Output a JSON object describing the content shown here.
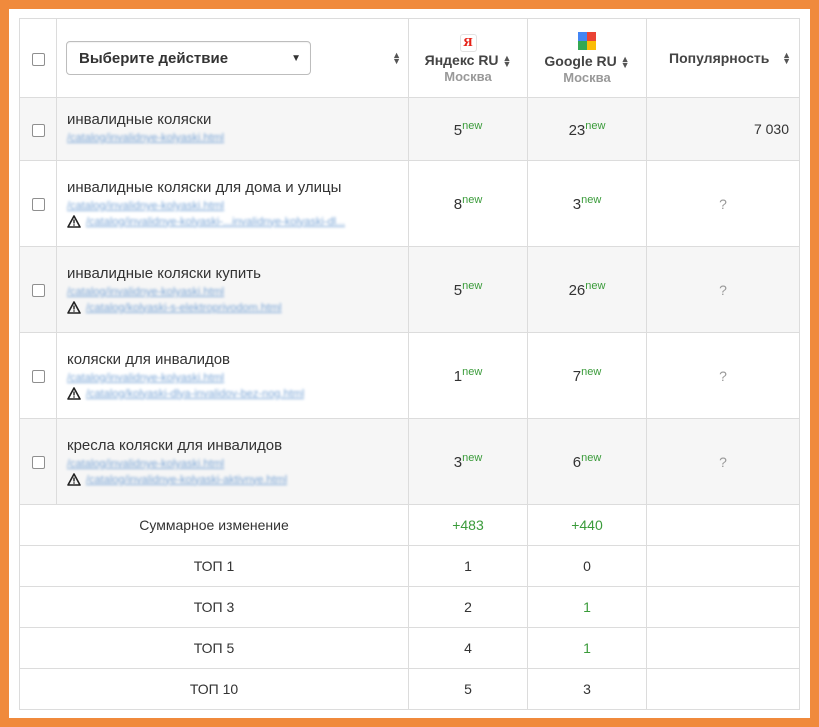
{
  "header": {
    "action_select": "Выберите действие",
    "yandex": {
      "name": "Яндекс RU",
      "city": "Москва",
      "logo": "Я"
    },
    "google": {
      "name": "Google RU",
      "city": "Москва"
    },
    "popularity": "Популярность"
  },
  "rows": [
    {
      "keyword": "инвалидные коляски",
      "url1": "/catalog/invalidnye-kolyaski.html",
      "url2": "",
      "yandex": "5",
      "google": "23",
      "badge": "new",
      "popularity": "7 030"
    },
    {
      "keyword": "инвалидные коляски для дома и улицы",
      "url1": "/catalog/invalidnye-kolyaski.html",
      "url2": "/catalog/invalidnye-kolyaski-...invalidnye-kolyaski-dl...",
      "yandex": "8",
      "google": "3",
      "badge": "new",
      "popularity": "?"
    },
    {
      "keyword": "инвалидные коляски купить",
      "url1": "/catalog/invalidnye-kolyaski.html",
      "url2": "/catalog/kolyaski-s-elektroprivodom.html",
      "yandex": "5",
      "google": "26",
      "badge": "new",
      "popularity": "?"
    },
    {
      "keyword": "коляски для инвалидов",
      "url1": "/catalog/invalidnye-kolyaski.html",
      "url2": "/catalog/kolyaski-dlya-invalidov-bez-nog.html",
      "yandex": "1",
      "google": "7",
      "badge": "new",
      "popularity": "?"
    },
    {
      "keyword": "кресла коляски для инвалидов",
      "url1": "/catalog/invalidnye-kolyaski.html",
      "url2": "/catalog/invalidnye-kolyaski-aktivnye.html",
      "yandex": "3",
      "google": "6",
      "badge": "new",
      "popularity": "?"
    }
  ],
  "summary": {
    "change_label": "Суммарное изменение",
    "yandex_change": "+483",
    "google_change": "+440",
    "tops": [
      {
        "label": "ТОП 1",
        "yandex": "1",
        "google": "0"
      },
      {
        "label": "ТОП 3",
        "yandex": "2",
        "google": "1"
      },
      {
        "label": "ТОП 5",
        "yandex": "4",
        "google": "1"
      },
      {
        "label": "ТОП 10",
        "yandex": "5",
        "google": "3"
      }
    ]
  },
  "colors": {
    "frame": "#f08a3c",
    "new_badge": "#3a9b3a",
    "link": "#7aa5d6"
  }
}
